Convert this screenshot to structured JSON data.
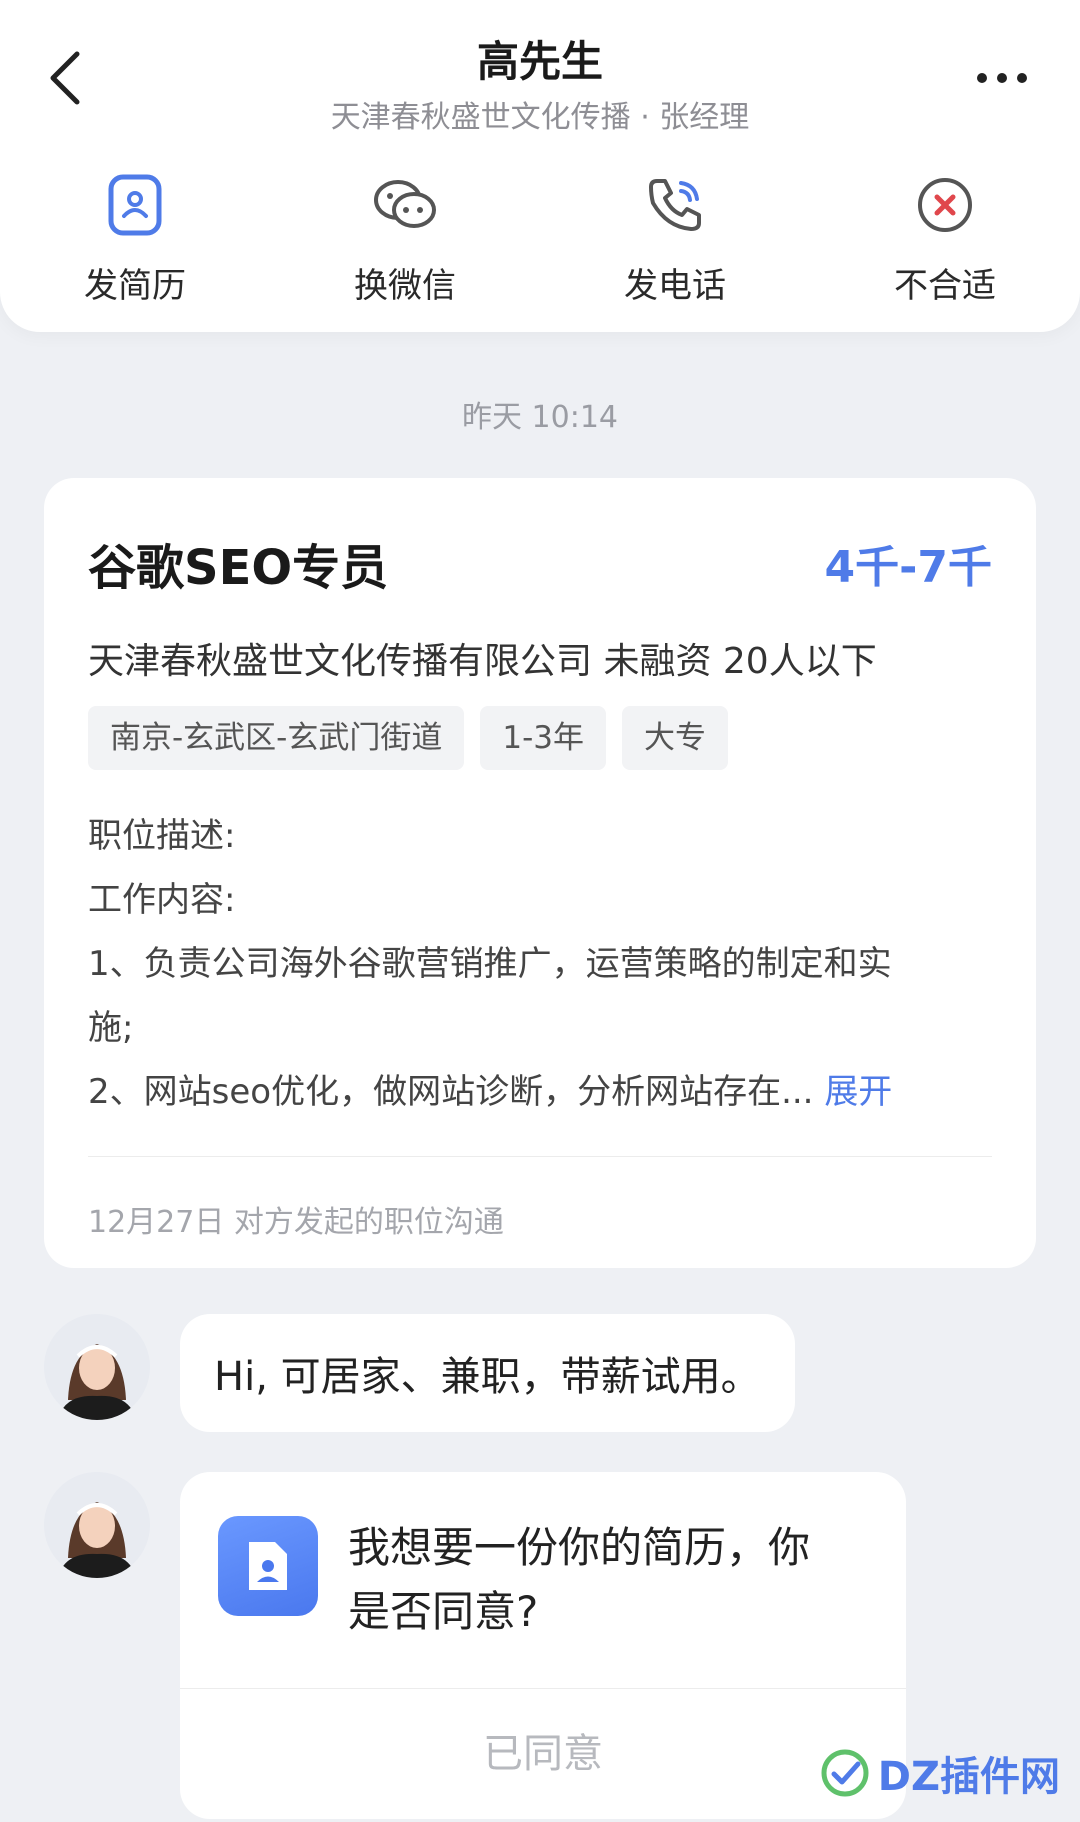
{
  "header": {
    "title": "高先生",
    "subtitle": "天津春秋盛世文化传播 · 张经理",
    "actions": [
      {
        "label": "发简历",
        "icon": "resume-icon"
      },
      {
        "label": "换微信",
        "icon": "wechat-icon"
      },
      {
        "label": "发电话",
        "icon": "phone-icon"
      },
      {
        "label": "不合适",
        "icon": "reject-icon"
      }
    ]
  },
  "timestamp": "昨天 10:14",
  "job": {
    "title": "谷歌SEO专员",
    "salary": "4千-7千",
    "company": "天津春秋盛世文化传播有限公司 未融资 20人以下",
    "tags": [
      "南京-玄武区-玄武门街道",
      "1-3年",
      "大专"
    ],
    "desc_lines": [
      "职位描述:",
      "工作内容:",
      "1、负责公司海外谷歌营销推广，运营策略的制定和实",
      "施;",
      "2、网站seo优化，做网站诊断，分析网站存在..."
    ],
    "expand_label": "展开",
    "footer": "12月27日 对方发起的职位沟通"
  },
  "messages": {
    "text_message": "Hi, 可居家、兼职，带薪试用。",
    "resume_request_line1": "我想要一份你的简历，你",
    "resume_request_line2": "是否同意?",
    "resume_action": "已同意"
  },
  "watermark": "DZ插件网",
  "colors": {
    "accent": "#4f7be8",
    "background": "#eef0f4",
    "reject": "#e0474c"
  }
}
